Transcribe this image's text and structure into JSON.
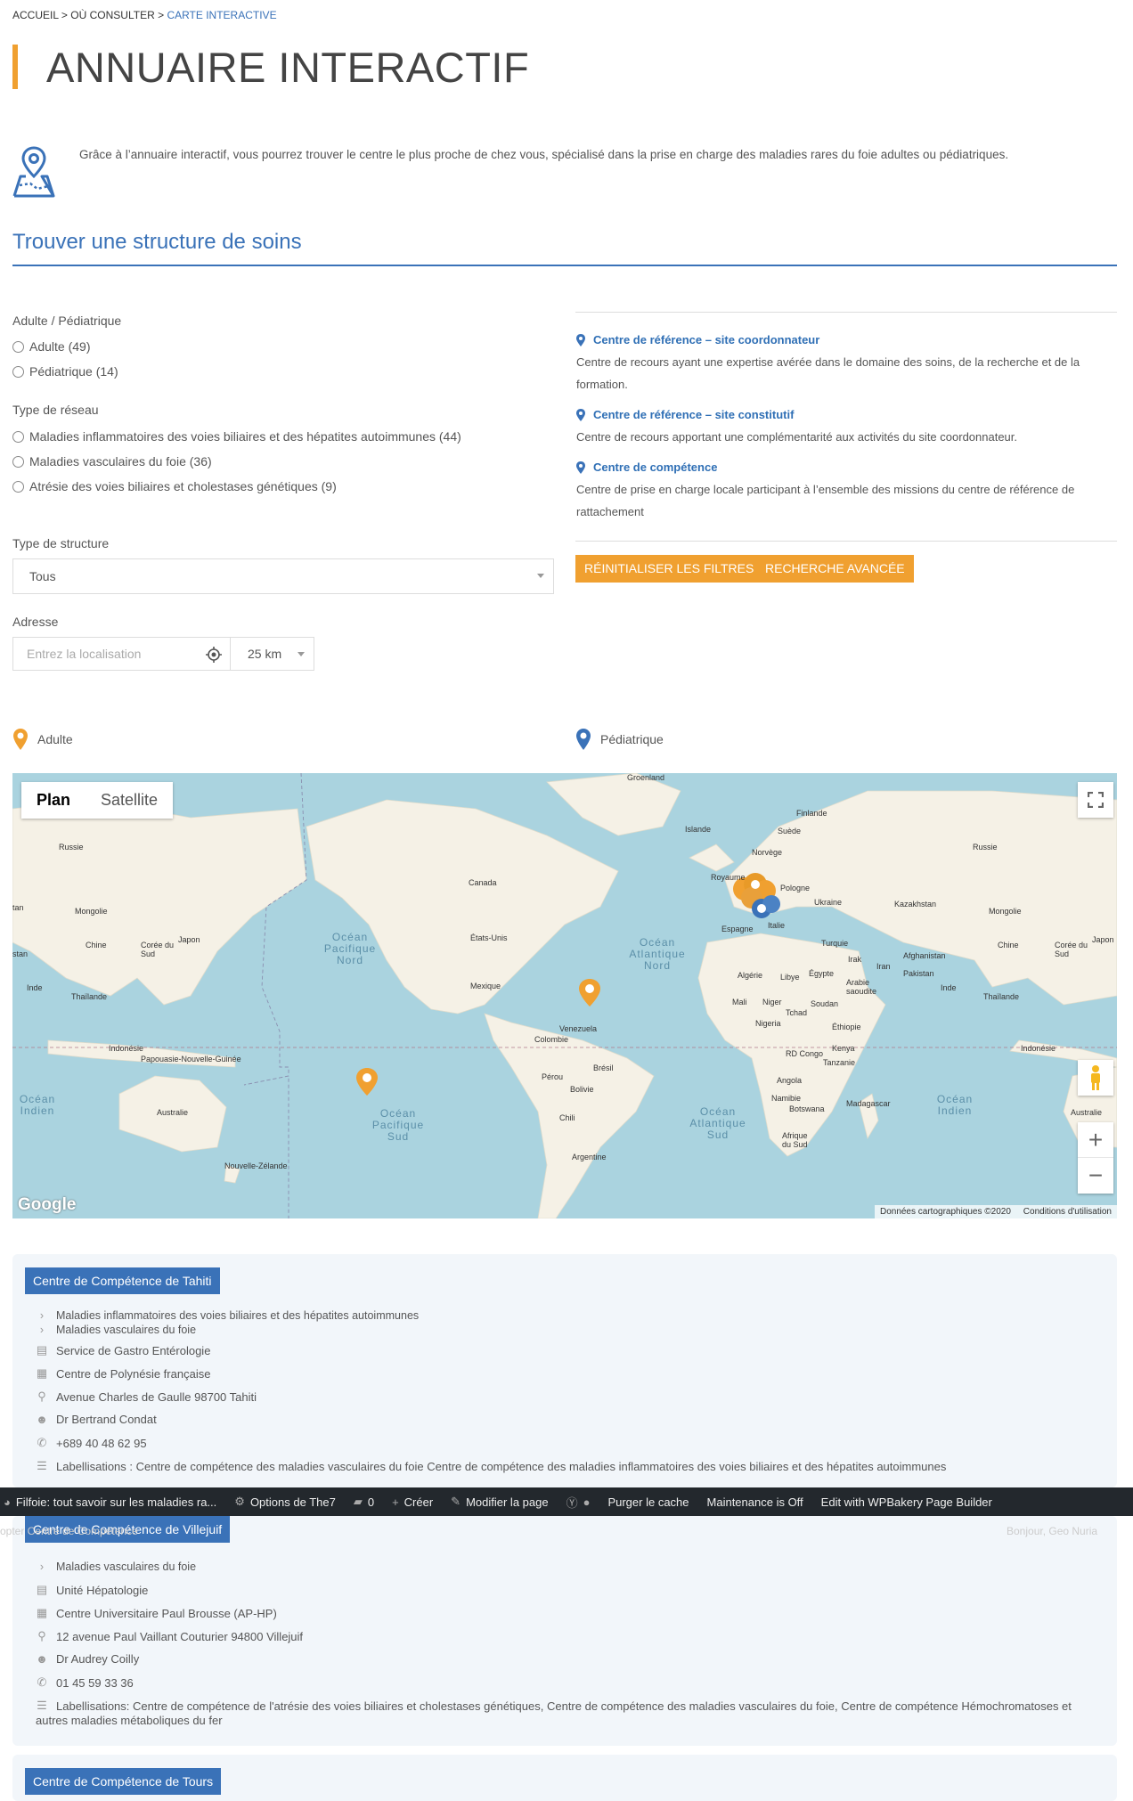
{
  "breadcrumb": {
    "home": "ACCUEIL",
    "sep": ">",
    "parent": "OÙ CONSULTER",
    "current": "CARTE INTERACTIVE"
  },
  "page_title": "ANNUAIRE INTERACTIF",
  "intro": "Grâce à l’annuaire interactif, vous pourrez trouver le centre le plus proche de chez vous, spécialisé dans la prise en charge des maladies rares du foie adultes ou pédiatriques.",
  "section_title": "Trouver une structure de soins",
  "filters": {
    "age_label": "Adulte / Pédiatrique",
    "age_options": [
      "Adulte (49)",
      "Pédiatrique (14)"
    ],
    "network_label": "Type de réseau",
    "network_options": [
      "Maladies inflammatoires des voies biliaires et des hépatites autoimmunes (44)",
      "Maladies vasculaires du foie (36)",
      "Atrésie des voies biliaires et cholestases génétiques (9)"
    ],
    "structure_label": "Type de structure",
    "structure_value": "Tous",
    "address_label": "Adresse",
    "address_placeholder": "Entrez la localisation",
    "radius_value": "25 km"
  },
  "legend": [
    {
      "title": "Centre de référence – site coordonnateur",
      "desc": "Centre de recours ayant une expertise avérée dans le domaine des soins, de la recherche et de la formation."
    },
    {
      "title": "Centre de référence – site constitutif",
      "desc": "Centre de recours apportant une complémentarité aux activités du site coordonnateur."
    },
    {
      "title": "Centre de compétence",
      "desc": "Centre de prise en charge locale participant à l’ensemble des missions du centre de référence de rattachement"
    }
  ],
  "buttons": {
    "reset": "RÉINITIALISER LES FILTRES",
    "advanced": "RECHERCHE AVANCÉE"
  },
  "map_legend": {
    "adult": "Adulte",
    "pediatric": "Pédiatrique"
  },
  "map": {
    "tab_plan": "Plan",
    "tab_satellite": "Satellite",
    "google": "Google",
    "attribution_data": "Données cartographiques ©2020",
    "attribution_terms": "Conditions d'utilisation",
    "labels": {
      "groenland": "Groenland",
      "islande": "Islande",
      "finlande": "Finlande",
      "suede": "Suède",
      "norvege": "Norvège",
      "russie_left": "Russie",
      "russie_right": "Russie",
      "royaume": "Royaume",
      "pologne": "Pologne",
      "ukraine": "Ukraine",
      "kazakhstan": "Kazakhstan",
      "mongolie_left": "Mongolie",
      "mongolie_right": "Mongolie",
      "canada": "Canada",
      "etats_unis": "États-Unis",
      "mexique": "Mexique",
      "chine_left": "Chine",
      "chine_right": "Chine",
      "japon_left": "Japon",
      "japon_right": "Japon",
      "coree_left": "Corée du Sud",
      "coree_right": "Corée du Sud",
      "inde_left": "Inde",
      "inde_right": "Inde",
      "thailande_left": "Thaïlande",
      "thailande_right": "Thaïlande",
      "espagne": "Espagne",
      "italie": "Italie",
      "turquie": "Turquie",
      "irak": "Irak",
      "iran": "Iran",
      "afghanistan": "Afghanistan",
      "pakistan": "Pakistan",
      "algerie": "Algérie",
      "libye": "Libye",
      "egypte": "Égypte",
      "arabie": "Arabie saoudite",
      "mali": "Mali",
      "niger": "Niger",
      "tchad": "Tchad",
      "soudan": "Soudan",
      "nigeria": "Nigeria",
      "ethiopie": "Éthiopie",
      "rd_congo": "RD Congo",
      "kenya": "Kenya",
      "tanzanie": "Tanzanie",
      "angola": "Angola",
      "namibie": "Namibie",
      "botswana": "Botswana",
      "madagascar": "Madagascar",
      "afrique_sud": "Afrique du Sud",
      "venezuela": "Venezuela",
      "colombie": "Colombie",
      "perou": "Pérou",
      "bresil": "Brésil",
      "bolivie": "Bolivie",
      "chili": "Chili",
      "argentine": "Argentine",
      "indonesie_left": "Indonésie",
      "indonesie_right": "Indonésie",
      "papouasie": "Papouasie-Nouvelle-Guinée",
      "australie_left": "Australie",
      "australie_right": "Australie",
      "nz": "Nouvelle-Zélande",
      "ocean_pac_nord": "Océan Pacifique Nord",
      "ocean_atl_nord": "Océan Atlantique Nord",
      "ocean_pac_sud": "Océan Pacifique Sud",
      "ocean_atl_sud": "Océan Atlantique Sud",
      "ocean_ind_left": "Océan Indien",
      "ocean_ind_right": "Océan Indien",
      "tan": "tan",
      "stan": "stan"
    }
  },
  "cards": [
    {
      "title": "Centre de Compétence de Tahiti",
      "networks": [
        "Maladies inflammatoires des voies biliaires et des hépatites autoimmunes",
        "Maladies vasculaires du foie"
      ],
      "service": "Service de Gastro Entérologie",
      "hospital": "Centre de Polynésie française",
      "address": "Avenue Charles de Gaulle 98700 Tahiti",
      "doctor": "Dr Bertrand Condat",
      "phone": "+689 40 48 62 95",
      "labels": "Labellisations : Centre de compétence des maladies vasculaires du foie Centre de compétence des maladies inflammatoires des voies biliaires et des hépatites autoimmunes"
    },
    {
      "title": "Centre de Compétence de Villejuif",
      "networks": [
        "Maladies vasculaires du foie"
      ],
      "service": "Unité Hépatologie",
      "hospital": "Centre Universitaire Paul Brousse (AP-HP)",
      "address": "12 avenue Paul Vaillant Couturier 94800 Villejuif",
      "doctor": "Dr Audrey Coilly",
      "phone": "01 45 59 33 36",
      "labels_1": "Labellisations: Centre de compétence de l'atrésie des voies biliaires et cholestases génétiques, Centre de compétence des maladies vasculaires du foie, Centre de compétence Hémochromatoses et",
      "labels_2": "autres maladies métaboliques du fer"
    },
    {
      "title": "Centre de Compétence de Tours"
    }
  ],
  "wpbar": {
    "site": "Filfoie: tout savoir sur les maladies ra...",
    "options": "Options de The7",
    "comments": "0",
    "create": "Créer",
    "edit": "Modifier la page",
    "purge": "Purger le cache",
    "maintenance": "Maintenance is Off",
    "wpbakery": "Edit with WPBakery Page Builder",
    "ghost_left": "opter Centre de Compétence",
    "ghost_right": "Bonjour, Geo Nuria"
  },
  "colors": {
    "accent_blue": "#3a72b8",
    "accent_orange": "#f0a030",
    "wpbar_bg": "#23282d"
  }
}
